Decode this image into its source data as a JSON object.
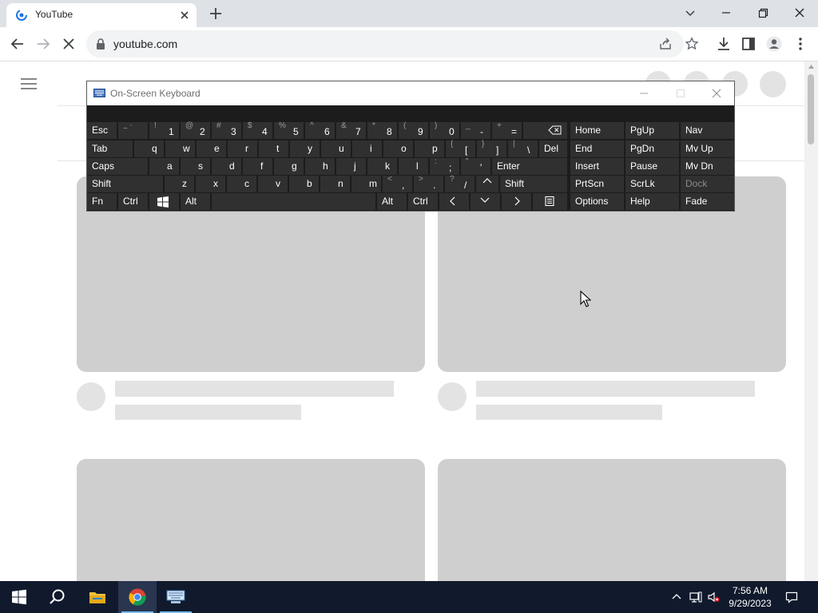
{
  "browser": {
    "tab": {
      "title": "YouTube"
    },
    "url": "youtube.com"
  },
  "osk": {
    "title": "On-Screen Keyboard",
    "rows": [
      [
        {
          "label": "Esc"
        },
        {
          "sym": "~ `"
        },
        {
          "sym": "!",
          "main": "1"
        },
        {
          "sym": "@",
          "main": "2"
        },
        {
          "sym": "#",
          "main": "3"
        },
        {
          "sym": "$",
          "main": "4"
        },
        {
          "sym": "%",
          "main": "5"
        },
        {
          "sym": "^",
          "main": "6"
        },
        {
          "sym": "&",
          "main": "7"
        },
        {
          "sym": "*",
          "main": "8"
        },
        {
          "sym": "(",
          "main": "9"
        },
        {
          "sym": ")",
          "main": "0"
        },
        {
          "sym": "_",
          "main": "-"
        },
        {
          "sym": "+",
          "main": "="
        },
        {
          "icon": "backspace"
        }
      ],
      [
        {
          "label": "Tab"
        },
        {
          "label": "q"
        },
        {
          "label": "w"
        },
        {
          "label": "e"
        },
        {
          "label": "r"
        },
        {
          "label": "t"
        },
        {
          "label": "y"
        },
        {
          "label": "u"
        },
        {
          "label": "i"
        },
        {
          "label": "o"
        },
        {
          "label": "p"
        },
        {
          "sym": "{",
          "main": "["
        },
        {
          "sym": "}",
          "main": "]"
        },
        {
          "sym": "|",
          "main": "\\"
        },
        {
          "label": "Del"
        }
      ],
      [
        {
          "label": "Caps"
        },
        {
          "label": "a"
        },
        {
          "label": "s"
        },
        {
          "label": "d"
        },
        {
          "label": "f"
        },
        {
          "label": "g"
        },
        {
          "label": "h"
        },
        {
          "label": "j"
        },
        {
          "label": "k"
        },
        {
          "label": "l"
        },
        {
          "sym": ":",
          "main": ";"
        },
        {
          "sym": "\"",
          "main": "'"
        },
        {
          "label": "Enter"
        }
      ],
      [
        {
          "label": "Shift"
        },
        {
          "label": "z"
        },
        {
          "label": "x"
        },
        {
          "label": "c"
        },
        {
          "label": "v"
        },
        {
          "label": "b"
        },
        {
          "label": "n"
        },
        {
          "label": "m"
        },
        {
          "sym": "<",
          "main": ","
        },
        {
          "sym": ">",
          "main": "."
        },
        {
          "sym": "?",
          "main": "/"
        },
        {
          "icon": "up"
        },
        {
          "label": "Shift"
        }
      ],
      [
        {
          "label": "Fn"
        },
        {
          "label": "Ctrl"
        },
        {
          "icon": "windows"
        },
        {
          "label": "Alt"
        },
        {
          "label": ""
        },
        {
          "label": "Alt"
        },
        {
          "label": "Ctrl"
        },
        {
          "icon": "left"
        },
        {
          "icon": "down"
        },
        {
          "icon": "right"
        },
        {
          "icon": "menu"
        }
      ]
    ],
    "nav": [
      [
        "Home",
        "PgUp",
        "Nav"
      ],
      [
        "End",
        "PgDn",
        "Mv Up"
      ],
      [
        "Insert",
        "Pause",
        "Mv Dn"
      ],
      [
        "PrtScn",
        "ScrLk",
        "Dock"
      ],
      [
        "Options",
        "Help",
        "Fade"
      ]
    ]
  },
  "taskbar": {
    "time": "7:56 AM",
    "date": "9/29/2023"
  }
}
